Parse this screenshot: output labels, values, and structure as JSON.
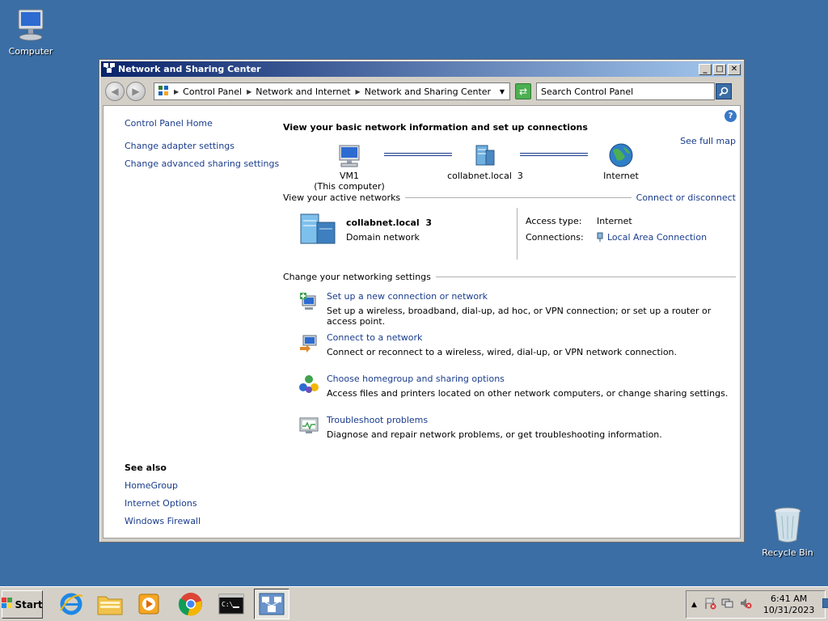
{
  "desktop": {
    "computer_label": "Computer",
    "recycle_label": "Recycle Bin"
  },
  "window": {
    "title": "Network and Sharing Center",
    "breadcrumbs": [
      "Control Panel",
      "Network and Internet",
      "Network and Sharing Center"
    ],
    "search_placeholder": "Search Control Panel"
  },
  "left_nav": {
    "home": "Control Panel Home",
    "items": [
      "Change adapter settings",
      "Change advanced sharing settings"
    ]
  },
  "see_also": {
    "heading": "See also",
    "items": [
      "HomeGroup",
      "Internet Options",
      "Windows Firewall"
    ]
  },
  "main": {
    "heading": "View your basic network information and set up connections",
    "see_full_map": "See full map",
    "map": {
      "computer_name": "VM1",
      "computer_sub": "(This computer)",
      "network": "collabnet.local  3",
      "internet": "Internet"
    },
    "active_header": "View your active networks",
    "connect_link": "Connect or disconnect",
    "active": {
      "name": "collabnet.local  3",
      "type": "Domain network",
      "access_label": "Access type:",
      "access_value": "Internet",
      "conn_label": "Connections:",
      "conn_value": "Local Area Connection"
    },
    "settings_header": "Change your networking settings",
    "tasks": [
      {
        "title": "Set up a new connection or network",
        "desc": "Set up a wireless, broadband, dial-up, ad hoc, or VPN connection; or set up a router or access point."
      },
      {
        "title": "Connect to a network",
        "desc": "Connect or reconnect to a wireless, wired, dial-up, or VPN network connection."
      },
      {
        "title": "Choose homegroup and sharing options",
        "desc": "Access files and printers located on other network computers, or change sharing settings."
      },
      {
        "title": "Troubleshoot problems",
        "desc": "Diagnose and repair network problems, or get troubleshooting information."
      }
    ]
  },
  "taskbar": {
    "start": "Start",
    "time": "6:41 AM",
    "date": "10/31/2023"
  }
}
